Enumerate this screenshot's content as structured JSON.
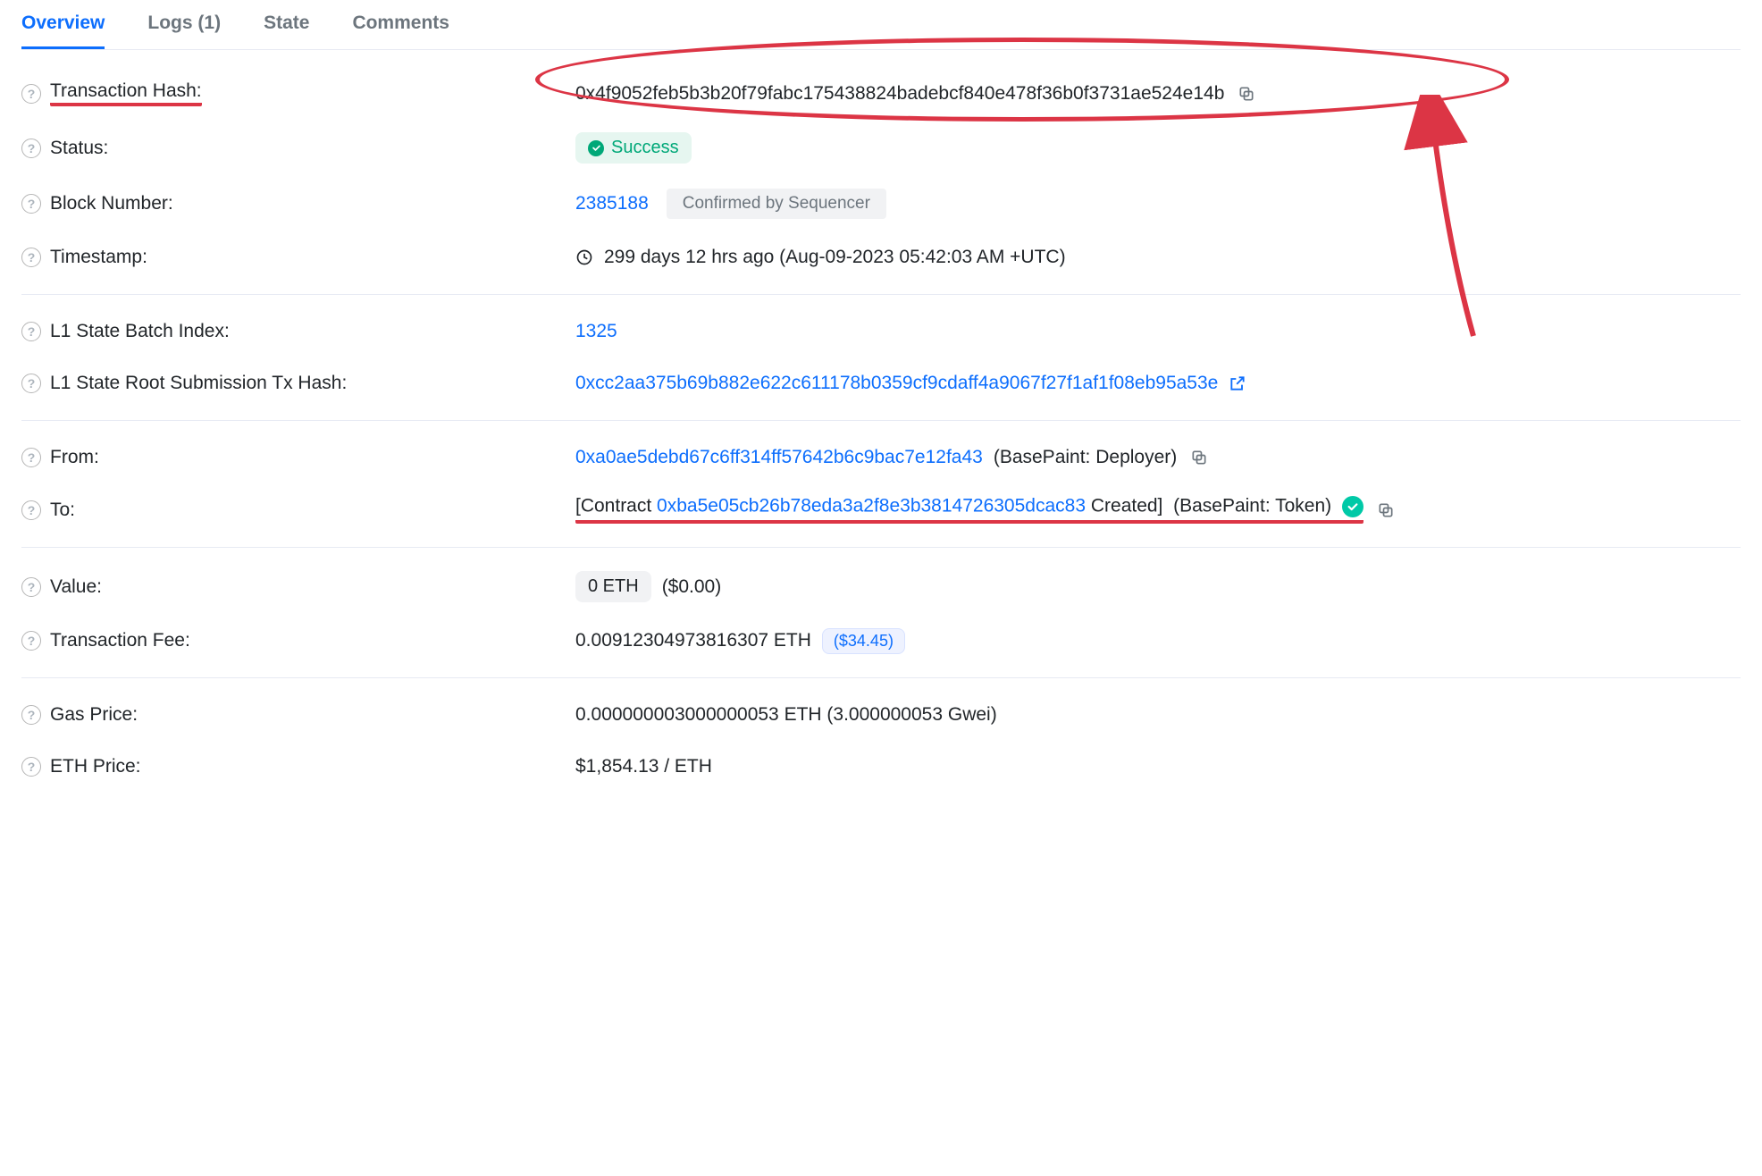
{
  "tabs": {
    "overview": "Overview",
    "logs": "Logs (1)",
    "state": "State",
    "comments": "Comments"
  },
  "labels": {
    "tx_hash": "Transaction Hash:",
    "status": "Status:",
    "block": "Block Number:",
    "timestamp": "Timestamp:",
    "l1_batch": "L1 State Batch Index:",
    "l1_root": "L1 State Root Submission Tx Hash:",
    "from": "From:",
    "to": "To:",
    "value": "Value:",
    "tx_fee": "Transaction Fee:",
    "gas_price": "Gas Price:",
    "eth_price": "ETH Price:"
  },
  "values": {
    "tx_hash": "0x4f9052feb5b3b20f79fabc175438824badebcf840e478f36b0f3731ae524e14b",
    "status": "Success",
    "block": "2385188",
    "confirm": "Confirmed by Sequencer",
    "timestamp": "299 days 12 hrs ago (Aug-09-2023 05:42:03 AM +UTC)",
    "l1_batch": "1325",
    "l1_root": "0xcc2aa375b69b882e622c611178b0359cf9cdaff4a9067f27f1af1f08eb95a53e",
    "from_addr": "0xa0ae5debd67c6ff314ff57642b6c9bac7e12fa43",
    "from_tag": "(BasePaint: Deployer)",
    "to_prefix": "[Contract ",
    "to_addr": "0xba5e05cb26b78eda3a2f8e3b3814726305dcac83",
    "to_suffix": " Created]",
    "to_tag": "(BasePaint: Token)",
    "value_eth": "0 ETH",
    "value_usd": "($0.00)",
    "tx_fee": "0.00912304973816307 ETH",
    "tx_fee_usd": "($34.45)",
    "gas_price": "0.000000003000000053 ETH (3.000000053 Gwei)",
    "eth_price": "$1,854.13 / ETH"
  }
}
